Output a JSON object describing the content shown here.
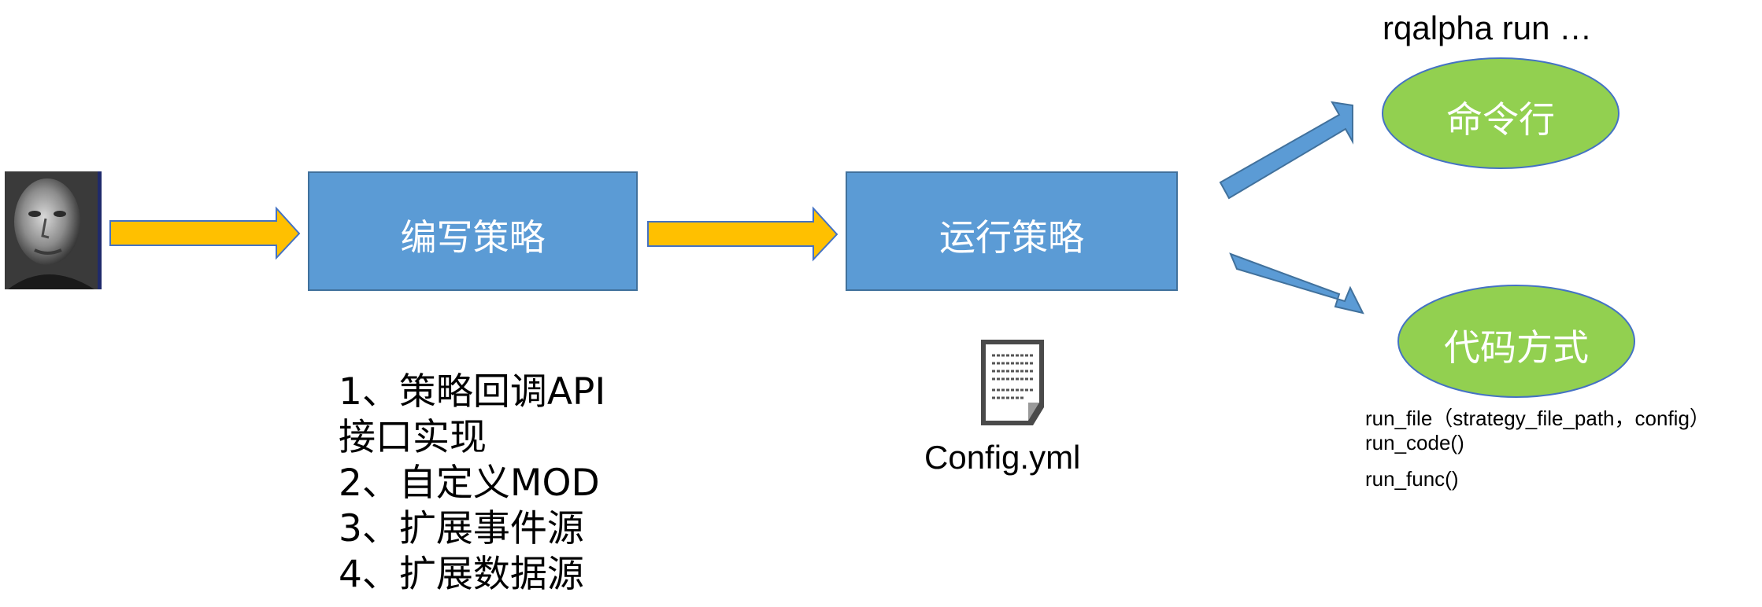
{
  "nodes": {
    "write_strategy": "编写策略",
    "run_strategy": "运行策略",
    "command_line": "命令行",
    "code_mode": "代码方式"
  },
  "command_example": "rqalpha run …",
  "write_steps": [
    "1、策略回调API",
    "接口实现",
    "2、自定义MOD",
    "3、扩展事件源",
    "4、扩展数据源"
  ],
  "config_file": "Config.yml",
  "code_functions": [
    "run_file（strategy_file_path，config）",
    "run_code()",
    "run_func()"
  ],
  "icons": {
    "person": "person-photo-icon",
    "config": "document-icon"
  },
  "colors": {
    "box_fill": "#5B9BD5",
    "box_border": "#41719C",
    "ellipse_fill": "#92D050",
    "ellipse_border": "#4472C4",
    "arrow_yellow": "#FFC000",
    "arrow_blue": "#5B9BD5"
  }
}
